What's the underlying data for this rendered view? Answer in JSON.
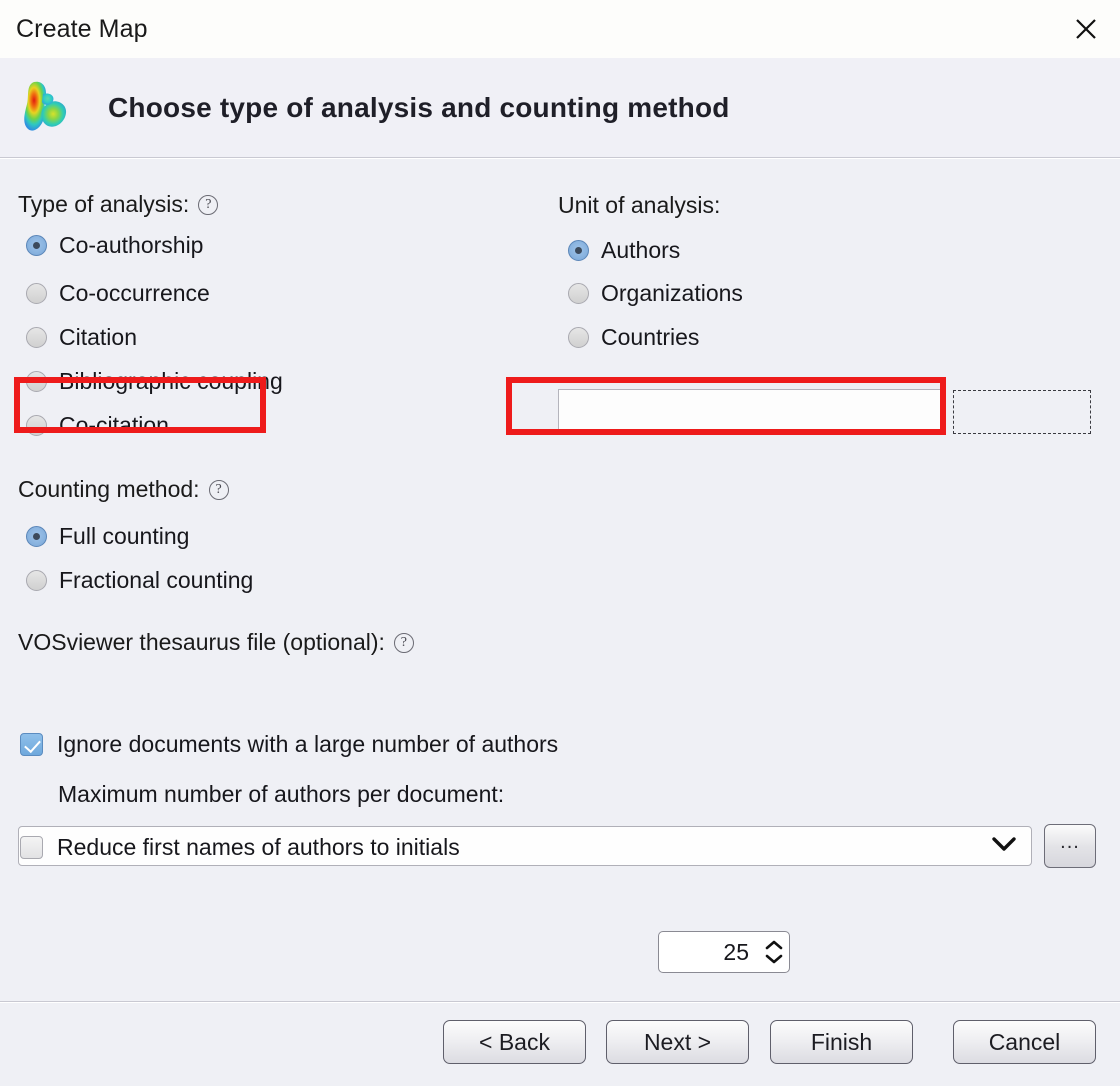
{
  "window": {
    "title": "Create Map",
    "close_icon": "close-icon"
  },
  "banner": {
    "logo_icon": "vosviewer-heatmap-logo-icon",
    "heading": "Choose type of analysis and counting method"
  },
  "type_of_analysis": {
    "label": "Type of analysis:",
    "help_icon": "help-circle-icon",
    "help_glyph": "?",
    "options": [
      {
        "label": "Co-authorship",
        "selected": true
      },
      {
        "label": "Co-occurrence",
        "selected": false
      },
      {
        "label": "Citation",
        "selected": false
      },
      {
        "label": "Bibliographic coupling",
        "selected": false
      },
      {
        "label": "Co-citation",
        "selected": false
      }
    ]
  },
  "unit_of_analysis": {
    "label": "Unit of analysis:",
    "options": [
      {
        "label": "Authors",
        "selected": true
      },
      {
        "label": "Organizations",
        "selected": false
      },
      {
        "label": "Countries",
        "selected": false
      }
    ]
  },
  "counting_method": {
    "label": "Counting method:",
    "help_icon": "help-circle-icon",
    "help_glyph": "?",
    "options": [
      {
        "label": "Full counting",
        "selected": true
      },
      {
        "label": "Fractional counting",
        "selected": false
      }
    ]
  },
  "thesaurus": {
    "label": "VOSviewer thesaurus file (optional):",
    "help_icon": "help-circle-icon",
    "help_glyph": "?",
    "value": "",
    "placeholder": "",
    "dropdown_icon": "chevron-down-icon",
    "browse_label": "...",
    "browse_icon": "ellipsis-icon"
  },
  "ignore_documents": {
    "label": "Ignore documents with a large number of authors",
    "checked": true
  },
  "max_authors": {
    "label": "Maximum number of authors per document:",
    "value": "25",
    "spinner_up_icon": "chevron-up-icon",
    "spinner_down_icon": "chevron-down-icon"
  },
  "reduce_first_names": {
    "label": "Reduce first names of authors to initials",
    "checked": false
  },
  "footer": {
    "back_label": "< Back",
    "next_label": "Next >",
    "finish_label": "Finish",
    "cancel_label": "Cancel"
  },
  "annotations": {
    "highlight_color": "#ee1b1b",
    "boxes": [
      "type-of-analysis-co-authorship",
      "unit-of-analysis-authors"
    ]
  }
}
